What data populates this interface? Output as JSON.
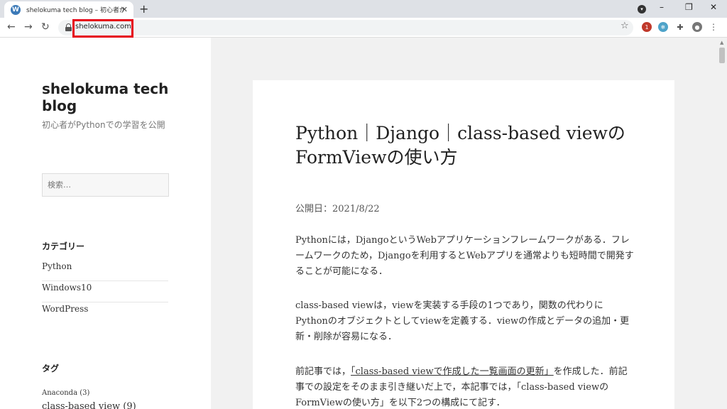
{
  "browser": {
    "tab_title": "shelokuma tech blog – 初心者が",
    "favicon": "W",
    "new_tab_glyph": "+",
    "close_tab_glyph": "✕",
    "address": "shelokuma.com",
    "window_minimize": "–",
    "window_restore": "❐",
    "window_close": "✕",
    "icons": {
      "back": "arrow-left-icon",
      "forward": "arrow-right-icon",
      "reload": "reload-icon",
      "lock": "lock-icon",
      "star": "star-icon",
      "extension_badge": "1"
    }
  },
  "sidebar": {
    "site_title": "shelokuma tech blog",
    "site_description": "初心者がPythonでの学習を公開",
    "search_placeholder": "検索…",
    "categories_heading": "カテゴリー",
    "categories": [
      "Python",
      "Windows10",
      "WordPress"
    ],
    "tags_heading": "タグ",
    "tags": [
      "Anaconda (3)",
      "class-based view (9)"
    ]
  },
  "article": {
    "title": "Python｜Django｜class-based viewのFormViewの使い方",
    "date": "公開日：2021/8/22",
    "paragraph1": "Pythonには，DjangoというWebアプリケーションフレームワークがある．フレームワークのため，Djangoを利用するとWebアプリを通常よりも短時間で開発することが可能になる．",
    "paragraph2": "class-based viewは，viewを実装する手段の1つであり，関数の代わりにPythonのオブジェクトとしてviewを定義する．viewの作成とデータの追加・更新・削除が容易になる．",
    "paragraph3_before": "前記事では，",
    "paragraph3_link": "「class-based viewで作成した一覧画面の更新」",
    "paragraph3_after": "を作成した．前記事での設定をそのまま引き継いだ上で，本記事では，「class-based viewのFormViewの使い方」を以下2つの構成にて記す．"
  }
}
